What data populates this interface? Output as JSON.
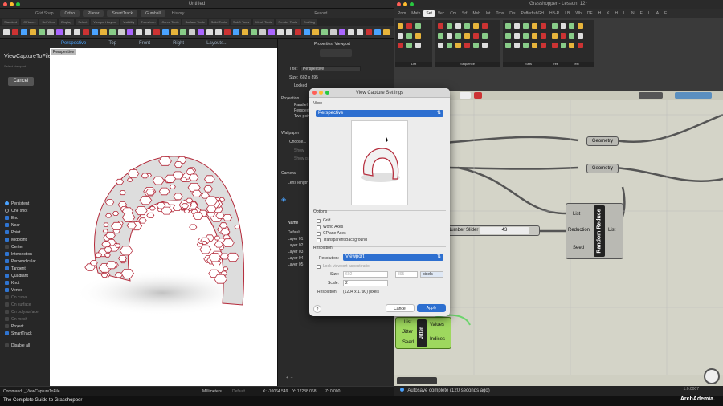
{
  "rhino": {
    "title": "Untitled",
    "snapbar": {
      "grid_snap": "Grid Snap",
      "ortho": "Ortho",
      "planar": "Planar",
      "smarttrack": "SmartTrack",
      "gumball": "Gumball",
      "history": "History",
      "record": "Record"
    },
    "toolbar_tabs": [
      "Standard",
      "CPlanes",
      "Set View",
      "Display",
      "Select",
      "Viewport Layout",
      "Visibility",
      "Transform",
      "Curve Tools",
      "Surface Tools",
      "Solid Tools",
      "SubD Tools",
      "Mesh Tools",
      "Render Tools",
      "Drafting"
    ],
    "viewport_tabs": [
      "Perspective",
      "Top",
      "Front",
      "Right",
      "Layouts..."
    ],
    "viewport_label": "Perspective",
    "command": {
      "title": "ViewCaptureToFile",
      "sub": "Select viewport...",
      "cancel": "Cancel"
    },
    "osnaps": [
      {
        "label": "Persistent",
        "kind": "radio",
        "on": true
      },
      {
        "label": "One shot",
        "kind": "radio",
        "on": false
      },
      {
        "label": "End",
        "kind": "check",
        "on": true
      },
      {
        "label": "Near",
        "kind": "check",
        "on": true
      },
      {
        "label": "Point",
        "kind": "check",
        "on": true
      },
      {
        "label": "Midpoint",
        "kind": "check",
        "on": true
      },
      {
        "label": "Center",
        "kind": "check",
        "on": false
      },
      {
        "label": "Intersection",
        "kind": "check",
        "on": true
      },
      {
        "label": "Perpendicular",
        "kind": "check",
        "on": true
      },
      {
        "label": "Tangent",
        "kind": "check",
        "on": true
      },
      {
        "label": "Quadrant",
        "kind": "check",
        "on": true
      },
      {
        "label": "Knot",
        "kind": "check",
        "on": true
      },
      {
        "label": "Vertex",
        "kind": "check",
        "on": true
      },
      {
        "label": "On curve",
        "kind": "check",
        "on": false,
        "dim": true
      },
      {
        "label": "On surface",
        "kind": "check",
        "on": false,
        "dim": true
      },
      {
        "label": "On polysurface",
        "kind": "check",
        "on": false,
        "dim": true
      },
      {
        "label": "On mesh",
        "kind": "check",
        "on": false,
        "dim": true
      },
      {
        "label": "Project",
        "kind": "check",
        "on": false
      },
      {
        "label": "SmartTrack",
        "kind": "check",
        "on": true
      },
      {
        "label": "Disable all",
        "kind": "check",
        "on": false
      }
    ],
    "properties": {
      "header": "Properties: Viewport",
      "title_label": "Title:",
      "title_value": "Perspective",
      "size_label": "Size:",
      "size_value": "602 x 895",
      "locked": "Locked",
      "projection": "Projection",
      "proj_opts": [
        "Parallel",
        "Perspective",
        "Two point"
      ],
      "wallpaper": "Wallpaper",
      "choose": "Choose...",
      "show": "Show",
      "show_gray": "Show grayscale",
      "camera": "Camera",
      "lens": "Lens length",
      "layers_header": "Name",
      "layers": [
        "Default",
        "Layer 01",
        "Layer 02",
        "Layer 03",
        "Layer 04",
        "Layer 05"
      ]
    },
    "status": {
      "command": "Command: _ViewCaptureToFile",
      "units": "Millimeters",
      "layer": "Default",
      "x": "X: -10064.549",
      "y": "Y: 12288.068",
      "z": "Z: 0.000"
    }
  },
  "dialog": {
    "title": "View Capture Settings",
    "view_section": "View",
    "view_value": "Perspective",
    "options_section": "Options",
    "options": [
      "Grid",
      "World Axes",
      "CPlane Axes",
      "Transparent Background"
    ],
    "resolution_section": "Resolution",
    "resolution_label": "Resolution:",
    "resolution_value": "Viewport",
    "lock_aspect": "Lock viewport aspect ratio",
    "size_label": "Size:",
    "size_w": "602",
    "size_h": "895",
    "units": "pixels",
    "scale_label": "Scale:",
    "scale_value": "2",
    "result_label": "Resolution:",
    "result_value": "(1204 x 1790) pixels",
    "help": "?",
    "cancel": "Cancel",
    "apply": "Apply"
  },
  "grasshopper": {
    "title": "Grasshopper - Lesson_12*",
    "categories": [
      "Prim",
      "Math",
      "Set",
      "Vec",
      "Crv",
      "Srf",
      "Msh",
      "Int",
      "Trns",
      "Dis",
      "PufferfishGH",
      "HB-R",
      "LB",
      "Wb",
      "DF",
      "H",
      "K",
      "H",
      "L",
      "N",
      "E",
      "L",
      "A",
      "E"
    ],
    "active_category": "Set",
    "ribbon_panels": [
      "List",
      "Sequence",
      "Sets",
      "Text",
      "Tree"
    ],
    "components": {
      "geometry1": "Geometry",
      "geometry2": "Geometry",
      "slider_label": "Number Slider",
      "slider_value": "43",
      "random_reduce": "Random Reduce",
      "rr_inputs": [
        "List",
        "Reduction",
        "Seed"
      ],
      "rr_output": "List",
      "jitter": "Jitter",
      "jitter_inputs": [
        "List",
        "Jitter",
        "Seed"
      ],
      "jitter_outputs": [
        "Values",
        "Indices"
      ]
    },
    "status": "Autosave complete (120 seconds ago)",
    "version": "1.0.0007"
  },
  "caption": "The Complete Guide to Grasshopper",
  "brand": "ArchAdemia."
}
